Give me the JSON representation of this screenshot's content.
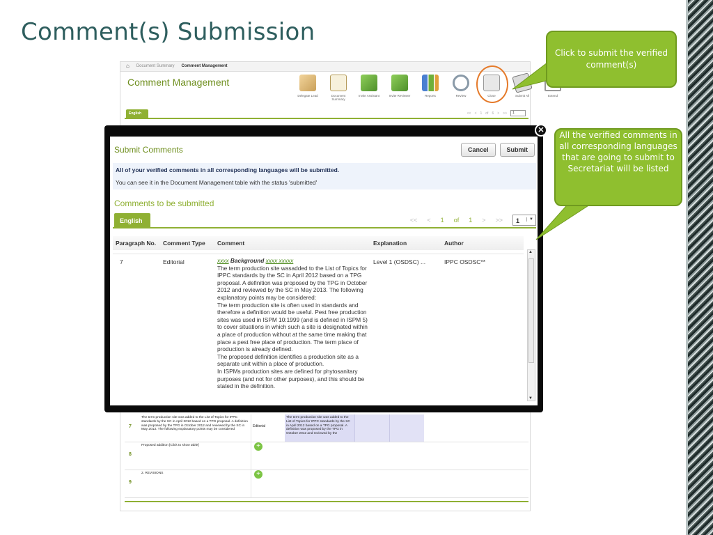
{
  "slide": {
    "title": "Comment(s) Submission"
  },
  "app": {
    "breadcrumbs": [
      "Document Summary",
      "Comment Management"
    ],
    "title": "Comment Management",
    "toolbar": [
      "Delegate Lead",
      "Document Summary",
      "Invite Assistant",
      "Invite Reviewer",
      "Reports",
      "Review",
      "Close",
      "Submit All",
      "Extend"
    ],
    "language_tab": "English",
    "pager": {
      "prev_all": "<<",
      "prev": "<",
      "page": "1",
      "of": "of",
      "total": "6",
      "next": ">",
      "next_all": ">>",
      "select": "1"
    },
    "rows": [
      {
        "num": "7",
        "text": "The term production site was added to the List of Topics for IPPC standards by the SC in April 2012 based on a TPG proposal. A definition was proposed by the TPG in October 2012 and reviewed by the SC in May 2013. The following explanatory points may be considered",
        "type": "Editorial",
        "text2": "The term production site was added to the List of Topics for IPPC standards by the SC in April 2012 based on a TPG proposal. A definition was proposed by the TPG in October 2012 and reviewed by the"
      },
      {
        "num": "8",
        "text": "Proposed addition [Click to show table]",
        "type": "",
        "text2": ""
      },
      {
        "num": "9",
        "text": "2. REVISIONS",
        "type": "",
        "text2": ""
      }
    ]
  },
  "modal": {
    "title": "Submit Comments",
    "cancel_label": "Cancel",
    "submit_label": "Submit",
    "info_line1": "All of your verified comments in all corresponding languages will be submitted.",
    "info_line2": "You can see it in the Document Management table with the status 'submitted'",
    "subheading": "Comments to be submitted",
    "language_tab": "English",
    "pager": {
      "prev_all": "<<",
      "prev": "<",
      "page": "1",
      "of": "of",
      "total": "1",
      "next": ">",
      "next_all": ">>",
      "select": "1"
    },
    "columns": {
      "para": "Paragraph No.",
      "type": "Comment Type",
      "comment": "Comment",
      "explanation": "Explanation",
      "author": "Author"
    },
    "row": {
      "para": "7",
      "type": "Editorial",
      "comment_prefix": "xxxx",
      "comment_heading": "Background",
      "comment_suffix": "xxxx xxxxx",
      "comment_body": "The term production site wasadded to the List of Topics for IPPC standards by the SC in April 2012 based on a TPG proposal. A definition was proposed by the TPG in October 2012 and reviewed by the SC in May 2013. The following explanatory points may be considered:",
      "comment_body2": "The term production site is often used in standards and therefore a definition would be useful. Pest free production sites was used in ISPM 10:1999 (and is defined in ISPM 5) to cover situations in which such a site is designated within a place of production without at the same time making that place a pest free place of production. The term place of production is already defined.",
      "comment_body3": "The proposed definition identifies a production site as a separate unit within a place of production.",
      "comment_body4": "In ISPMs production sites are defined for phytosanitary purposes (and not for other purposes), and this should be stated in the definition.",
      "explanation": "Level 1 (OSDSC) ...",
      "author": "IPPC OSDSC**"
    }
  },
  "callouts": {
    "submit_all": "Click to submit the verified comment(s)",
    "listed": "All the verified comments in all corresponding languages that are going to submit to Secretariat will be listed"
  },
  "colors": {
    "accent": "#8fb033",
    "callout": "#8fbf2f",
    "title": "#2e5e5e",
    "highlight_ring": "#e57a2a"
  }
}
